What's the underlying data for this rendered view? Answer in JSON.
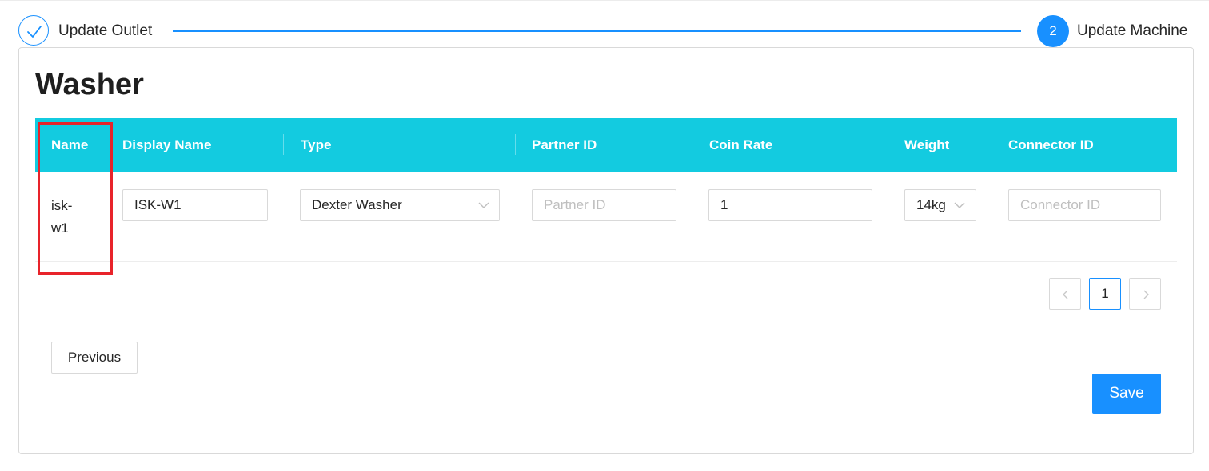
{
  "steps": [
    {
      "title": "Update Outlet",
      "status": "done",
      "icon": "check-icon"
    },
    {
      "title": "Update Machine",
      "status": "active",
      "number": "2"
    }
  ],
  "accent_color": "#1890ff",
  "header_color": "#13cbe0",
  "highlight_color": "#e8232a",
  "section_title": "Washer",
  "table": {
    "columns": [
      "Name",
      "Display Name",
      "Type",
      "Partner ID",
      "Coin Rate",
      "Weight",
      "Connector ID"
    ],
    "rows": [
      {
        "name_line1": "isk-",
        "name_line2": "w1",
        "display_name": "ISK-W1",
        "type": "Dexter Washer",
        "partner_id": "",
        "partner_id_placeholder": "Partner ID",
        "coin_rate": "1",
        "weight": "14kg",
        "connector_id": "",
        "connector_id_placeholder": "Connector ID"
      }
    ]
  },
  "pagination": {
    "current": "1"
  },
  "buttons": {
    "previous": "Previous",
    "save": "Save"
  }
}
